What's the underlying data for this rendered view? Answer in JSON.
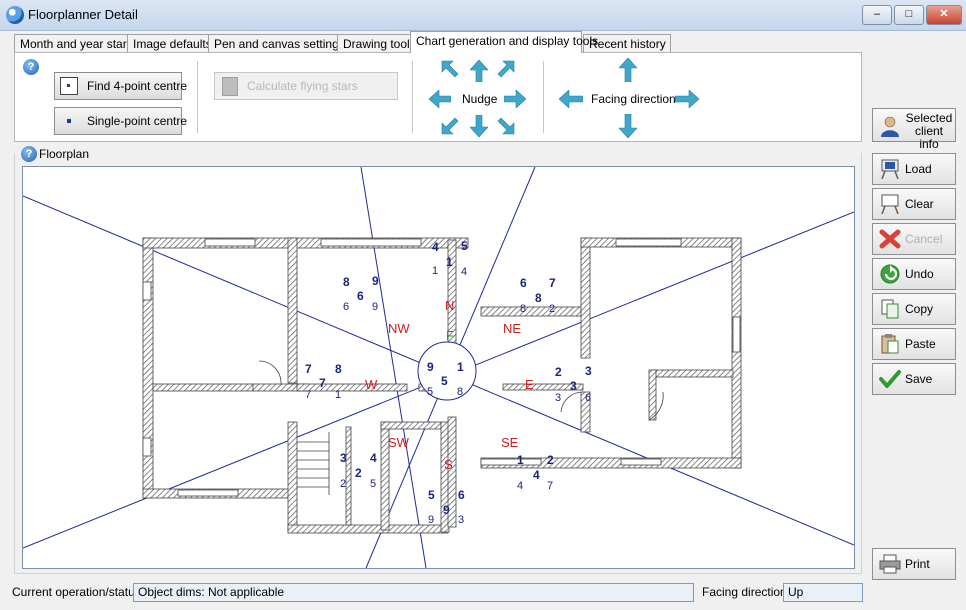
{
  "window": {
    "title": "Floorplanner Detail"
  },
  "tabs": [
    {
      "label": "Month and year stars"
    },
    {
      "label": "Image defaults"
    },
    {
      "label": "Pen and canvas settings"
    },
    {
      "label": "Drawing tools"
    },
    {
      "label": "Chart generation and display tools"
    },
    {
      "label": "Recent history"
    }
  ],
  "toolbar": {
    "find_centre_label": "Find 4-point centre",
    "single_centre_label": "Single-point centre",
    "calc_stars_label": "Calculate flying stars",
    "nudge_label": "Nudge",
    "facing_label": "Facing direction"
  },
  "floorplan": {
    "label": "Floorplan",
    "directions": [
      "N",
      "NE",
      "E",
      "SE",
      "S",
      "SW",
      "W",
      "NW"
    ],
    "facing_marker": "F",
    "centre_stars": {
      "top_left": "9",
      "top_right": "1",
      "mid": "5",
      "bottom_left": "5",
      "bottom_right": "8"
    },
    "sectors": {
      "NW": {
        "row1": [
          "8",
          "9"
        ],
        "row2": "6",
        "row3": [
          "6",
          "9"
        ]
      },
      "N": {
        "row1": [
          "4",
          "5"
        ],
        "row2": [
          "1",
          "1"
        ],
        "row3": "4"
      },
      "NE": {
        "row1": [
          "6",
          "7"
        ],
        "row2": "8",
        "row3": [
          "8",
          "2"
        ]
      },
      "E": {
        "row1": "2",
        "row2": [
          "3",
          "3"
        ],
        "row3": [
          "3",
          "6"
        ]
      },
      "SE": {
        "row1": [
          "1",
          "2"
        ],
        "row2": "4",
        "row3": [
          "4",
          "7"
        ]
      },
      "S": {
        "row1": [
          "5",
          "6"
        ],
        "row2": "9",
        "row3": [
          "9",
          "3"
        ]
      },
      "SW": {
        "row1": [
          "3",
          "4"
        ],
        "row2": "2",
        "row3": [
          "2",
          "5"
        ]
      },
      "W": {
        "row1": [
          "7",
          "8"
        ],
        "row2": "7",
        "row3": [
          "7",
          "1"
        ]
      }
    }
  },
  "side_buttons": [
    {
      "label": "Selected client info"
    },
    {
      "label": "Load"
    },
    {
      "label": "Clear"
    },
    {
      "label": "Cancel"
    },
    {
      "label": "Undo"
    },
    {
      "label": "Copy"
    },
    {
      "label": "Paste"
    },
    {
      "label": "Save"
    },
    {
      "label": "Print"
    }
  ],
  "status": {
    "operation_label": "Current operation/status:",
    "operation_value": "Object dims: Not applicable",
    "facing_label": "Facing direction:",
    "facing_value": "Up"
  },
  "colors": {
    "star_blue": "#1a237e",
    "direction_red": "#cc1f1f",
    "facing_green": "#2e8b2e",
    "arrow_teal": "#3fa7c9"
  }
}
